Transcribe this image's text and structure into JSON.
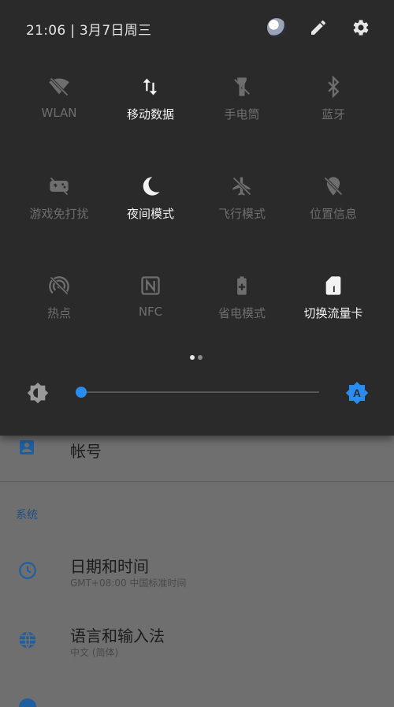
{
  "status_bar": {
    "time_date": "21:06 | 3月7日周三"
  },
  "quick_settings": {
    "tiles": [
      {
        "label": "WLAN",
        "icon": "wifi-off-icon",
        "active": false
      },
      {
        "label": "移动数据",
        "icon": "mobile-data-icon",
        "active": true
      },
      {
        "label": "手电筒",
        "icon": "flashlight-icon",
        "active": false
      },
      {
        "label": "蓝牙",
        "icon": "bluetooth-icon",
        "active": false
      },
      {
        "label": "游戏免打扰",
        "icon": "game-dnd-icon",
        "active": false
      },
      {
        "label": "夜间模式",
        "icon": "moon-icon",
        "active": true
      },
      {
        "label": "飞行模式",
        "icon": "airplane-icon",
        "active": false
      },
      {
        "label": "位置信息",
        "icon": "location-off-icon",
        "active": false
      },
      {
        "label": "热点",
        "icon": "hotspot-icon",
        "active": false
      },
      {
        "label": "NFC",
        "icon": "nfc-icon",
        "active": false
      },
      {
        "label": "省电模式",
        "icon": "battery-saver-icon",
        "active": false
      },
      {
        "label": "切换流量卡",
        "icon": "sim-card-icon",
        "active": true
      }
    ],
    "page_index": 1,
    "page_count": 2,
    "brightness": {
      "level": 0.0,
      "auto": true,
      "auto_label": "A"
    }
  },
  "settings_list": {
    "account": {
      "title": "帐号",
      "icon": "account-icon"
    },
    "section_header": "系统",
    "items": [
      {
        "title": "日期和时间",
        "subtitle": "GMT+08:00 中国标准时间",
        "icon": "clock-icon"
      },
      {
        "title": "语言和输入法",
        "subtitle": "中文 (简体)",
        "icon": "globe-icon"
      }
    ]
  },
  "colors": {
    "accent": "#2a8cf0",
    "panel": "#2a2a2a",
    "inactive": "#6e6e6e",
    "active": "#f2f2f2"
  }
}
